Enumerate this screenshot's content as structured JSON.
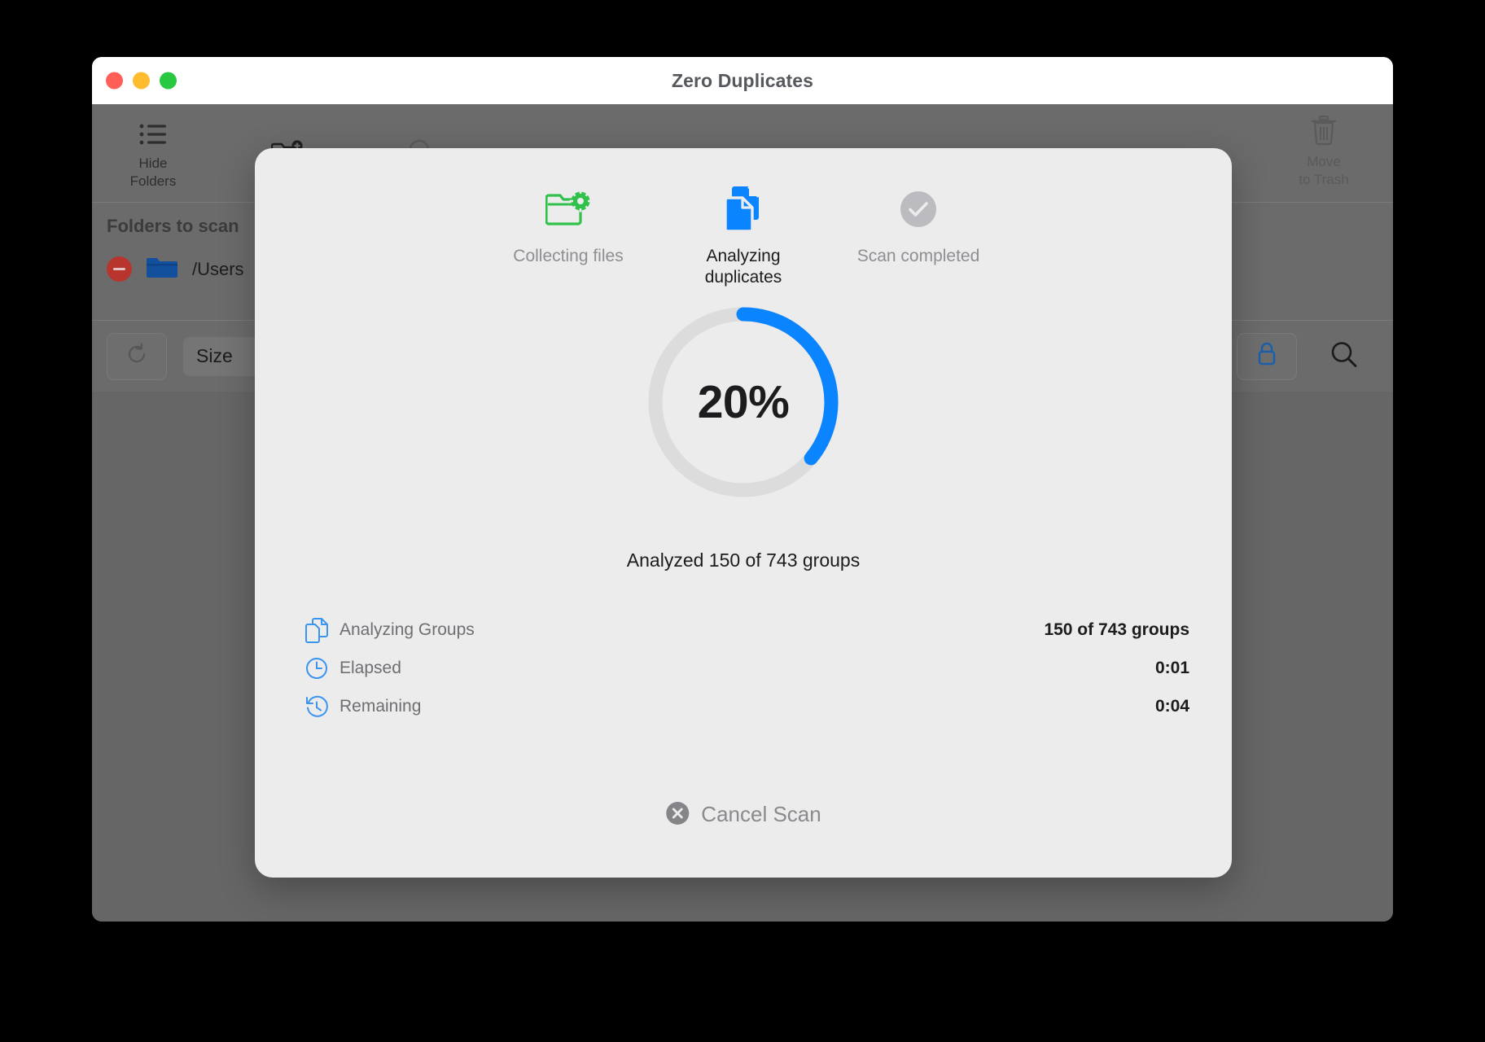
{
  "window": {
    "title": "Zero Duplicates",
    "traffic_lights": [
      {
        "name": "close",
        "color": "#ff5f57"
      },
      {
        "name": "minimize",
        "color": "#febc2e"
      },
      {
        "name": "zoom",
        "color": "#28c840"
      }
    ]
  },
  "toolbar": {
    "items": [
      {
        "name": "hide-folders",
        "icon": "list-icon",
        "label": "Hide\nFolders"
      },
      {
        "name": "add-folder",
        "icon": "folder-add-icon",
        "label": ""
      },
      {
        "name": "scan",
        "icon": "search-icon",
        "label": ""
      },
      {
        "name": "move-to-trash",
        "icon": "trash-icon",
        "label": "Move\nto Trash"
      }
    ]
  },
  "folders_section": {
    "heading": "Folders to scan",
    "rows": [
      {
        "remove_icon": "minus-circle-icon",
        "folder_icon": "folder-icon",
        "path": "/Users"
      }
    ]
  },
  "filter_bar": {
    "refresh_icon": "refresh-icon",
    "size_filter_label": "Size",
    "lock_icon": "lock-icon",
    "search_icon": "search-icon"
  },
  "modal": {
    "steps": [
      {
        "name": "collecting-files",
        "icon": "folder-gear-icon",
        "label": "Collecting files",
        "state": "done"
      },
      {
        "name": "analyzing-duplicates",
        "icon": "duplicate-documents-icon",
        "label": "Analyzing\nduplicates",
        "state": "active"
      },
      {
        "name": "scan-completed",
        "icon": "check-circle-icon",
        "label": "Scan completed",
        "state": "pending"
      }
    ],
    "progress": {
      "percent_label": "20%",
      "percent_value": 20,
      "arc_fraction": 0.36,
      "track_color": "#dcdcdc",
      "fill_color": "#0a84ff"
    },
    "caption": "Analyzed 150 of 743 groups",
    "details": [
      {
        "name": "analyzing-groups",
        "icon": "documents-outline-icon",
        "label": "Analyzing Groups",
        "value": "150 of 743 groups"
      },
      {
        "name": "elapsed",
        "icon": "clock-icon",
        "label": "Elapsed",
        "value": "0:01"
      },
      {
        "name": "remaining",
        "icon": "clock-reverse-icon",
        "label": "Remaining",
        "value": "0:04"
      }
    ],
    "cancel": {
      "icon": "x-circle-icon",
      "label": "Cancel Scan"
    }
  },
  "colors": {
    "accent_blue": "#0a84ff",
    "accent_green": "#2fc14a",
    "muted_gray": "#8e8e93"
  }
}
